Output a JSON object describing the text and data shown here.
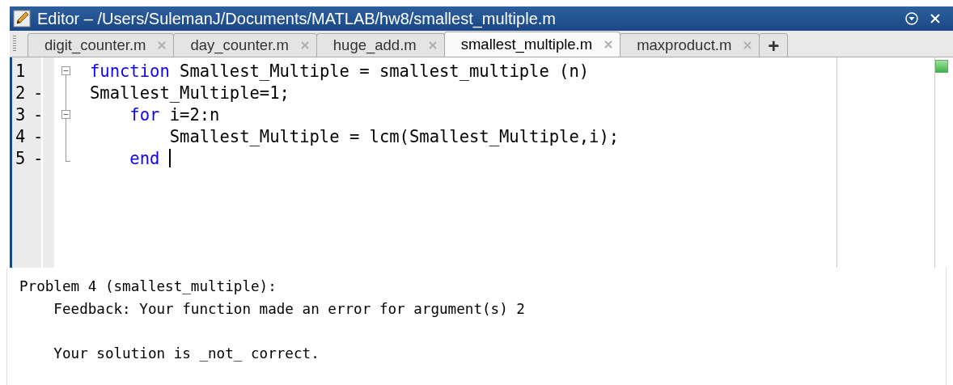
{
  "window": {
    "title": "Editor – /Users/SulemanJ/Documents/MATLAB/hw8/smallest_multiple.m"
  },
  "tabs": [
    {
      "label": "digit_counter.m",
      "selected": false
    },
    {
      "label": "day_counter.m",
      "selected": false
    },
    {
      "label": "huge_add.m",
      "selected": false
    },
    {
      "label": "smallest_multiple.m",
      "selected": true
    },
    {
      "label": "maxproduct.m",
      "selected": false
    }
  ],
  "new_tab": "+",
  "code_lines": [
    {
      "number": "1",
      "foldable": true,
      "cursor": false,
      "tokens": [
        {
          "kind": "keyword",
          "text": "function"
        },
        {
          "kind": "plain",
          "text": " Smallest_Multiple = smallest_multiple (n)"
        }
      ]
    },
    {
      "number": "2",
      "marker": "-",
      "foldable": false,
      "cursor": false,
      "tokens": [
        {
          "kind": "plain",
          "text": "Smallest_Multiple=1;"
        }
      ]
    },
    {
      "number": "3",
      "marker": "-",
      "foldable": true,
      "cursor": false,
      "tokens": [
        {
          "kind": "keyword",
          "text": "    for"
        },
        {
          "kind": "plain",
          "text": " i=2:n"
        }
      ]
    },
    {
      "number": "4",
      "marker": "-",
      "foldable": false,
      "cursor": false,
      "tokens": [
        {
          "kind": "plain",
          "text": "        Smallest_Multiple = lcm(Smallest_Multiple,i);"
        }
      ]
    },
    {
      "number": "5",
      "marker": "-",
      "foldable": false,
      "cursor": true,
      "tokens": [
        {
          "kind": "keyword",
          "text": "    end"
        }
      ]
    }
  ],
  "output_lines": [
    {
      "text": "Problem 4 (smallest_multiple):",
      "gap_before": false
    },
    {
      "text": "    Feedback: Your function made an error for argument(s) 2",
      "gap_before": false
    },
    {
      "text": "    Your solution is _not_ correct.",
      "gap_before": true
    }
  ]
}
